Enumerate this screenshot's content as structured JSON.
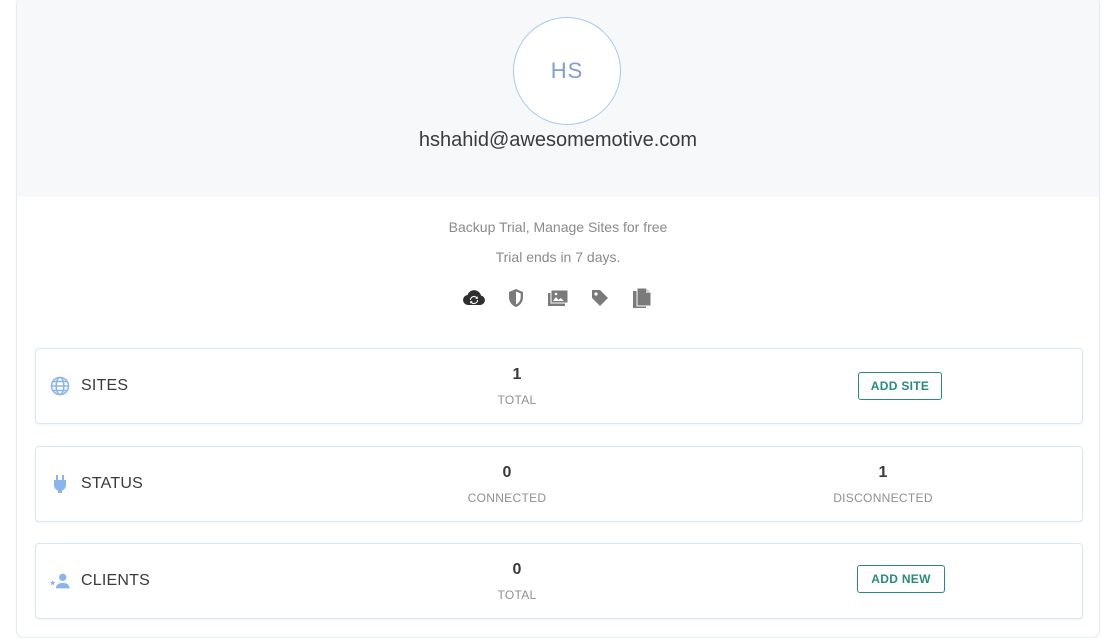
{
  "profile": {
    "initials": "HS",
    "email": "hshahid@awesomemotive.com",
    "plan": "Backup Trial, Manage Sites for free",
    "trial": "Trial ends in 7 days."
  },
  "features": [
    "cloud-sync-icon",
    "shield-icon",
    "photo-gallery-icon",
    "tag-icon",
    "document-icon"
  ],
  "colors": {
    "accent": "#2a8a7d",
    "icon_blue": "#8ab4f0",
    "avatar_border": "#a9c8ee"
  },
  "sites": {
    "label": "SITES",
    "total_value": "1",
    "total_caption": "TOTAL",
    "button": "ADD SITE"
  },
  "status": {
    "label": "STATUS",
    "connected_value": "0",
    "connected_caption": "CONNECTED",
    "disconnected_value": "1",
    "disconnected_caption": "DISCONNECTED"
  },
  "clients": {
    "label": "CLIENTS",
    "total_value": "0",
    "total_caption": "TOTAL",
    "button": "ADD NEW"
  }
}
